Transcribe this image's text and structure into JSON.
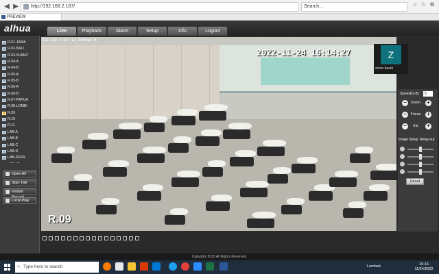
{
  "browser": {
    "url": "http://192.168.2.167/",
    "search_placeholder": "Search...",
    "tab_title": "PREVIEW"
  },
  "app": {
    "logo": "alhua",
    "menu": [
      "Live",
      "Playback",
      "Alarm",
      "Setup",
      "Info",
      "Logout"
    ],
    "active_menu": "Live"
  },
  "channels": [
    "R.01-JAWA",
    "R.02-BALI",
    "R.03-SUMAT",
    "R.04-A",
    "R.04-B",
    "R.05-A",
    "R.05-B",
    "R.06-A",
    "R.06-B",
    "R.07-PAPUA",
    "R.08-LOMBI",
    "R.09",
    "R.10",
    "R.11",
    "LAB-A",
    "LAB-B",
    "LAB-C",
    "LAB-D",
    "LAB-JRGN",
    "LAB-LT"
  ],
  "selected_channel": "R.09",
  "side_buttons": [
    "Open All",
    "Start Talk",
    "Instant Record",
    "Local Play"
  ],
  "video": {
    "osd_top": "192.168.2.167_12_7RFKbps_M",
    "osd_time": "2022-11-24 16:14:27",
    "osd_name": "R.09"
  },
  "zoom_overlay": {
    "avatar": "Z",
    "name": "zoom baadi"
  },
  "ptz": {
    "speed_label": "Speed(1-8)",
    "speed_value": "5",
    "zoom_label": "Zoom",
    "focus_label": "Focus",
    "iris_label": "Iris",
    "image_setup": "Image Setup",
    "relay_out": "Relay-out",
    "reset_label": "Reset"
  },
  "copyright": "Copyright 2015 All Rights Reserved.",
  "taskbar": {
    "search_text": "Type here to search",
    "weather": "Lembab",
    "time": "16:16",
    "date": "11/24/2022"
  },
  "colors": {
    "app_bg": "#2a2a2a",
    "panel_bg": "#3b3b3b",
    "taskbar_bg": "#1f2d3d",
    "zoom_teal": "#0e717b"
  }
}
